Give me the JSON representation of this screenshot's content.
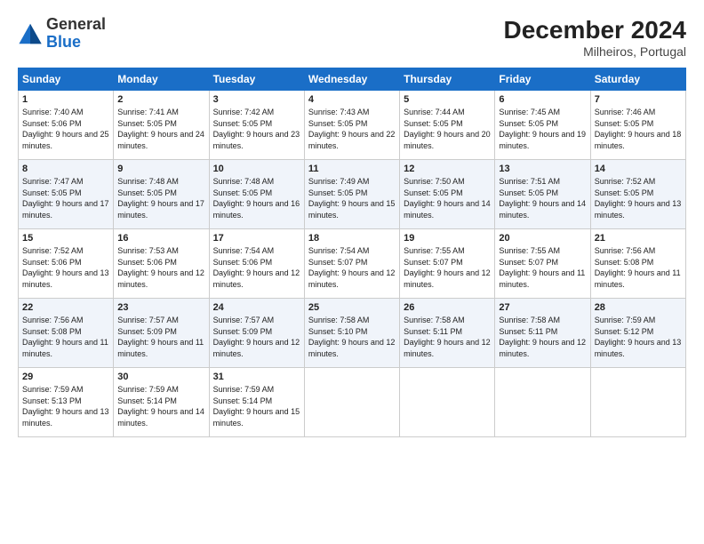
{
  "logo": {
    "general": "General",
    "blue": "Blue"
  },
  "title": "December 2024",
  "subtitle": "Milheiros, Portugal",
  "days": [
    "Sunday",
    "Monday",
    "Tuesday",
    "Wednesday",
    "Thursday",
    "Friday",
    "Saturday"
  ],
  "weeks": [
    [
      {
        "day": 1,
        "sunrise": "7:40 AM",
        "sunset": "5:06 PM",
        "daylight": "9 hours and 25 minutes."
      },
      {
        "day": 2,
        "sunrise": "7:41 AM",
        "sunset": "5:05 PM",
        "daylight": "9 hours and 24 minutes."
      },
      {
        "day": 3,
        "sunrise": "7:42 AM",
        "sunset": "5:05 PM",
        "daylight": "9 hours and 23 minutes."
      },
      {
        "day": 4,
        "sunrise": "7:43 AM",
        "sunset": "5:05 PM",
        "daylight": "9 hours and 22 minutes."
      },
      {
        "day": 5,
        "sunrise": "7:44 AM",
        "sunset": "5:05 PM",
        "daylight": "9 hours and 20 minutes."
      },
      {
        "day": 6,
        "sunrise": "7:45 AM",
        "sunset": "5:05 PM",
        "daylight": "9 hours and 19 minutes."
      },
      {
        "day": 7,
        "sunrise": "7:46 AM",
        "sunset": "5:05 PM",
        "daylight": "9 hours and 18 minutes."
      }
    ],
    [
      {
        "day": 8,
        "sunrise": "7:47 AM",
        "sunset": "5:05 PM",
        "daylight": "9 hours and 17 minutes."
      },
      {
        "day": 9,
        "sunrise": "7:48 AM",
        "sunset": "5:05 PM",
        "daylight": "9 hours and 17 minutes."
      },
      {
        "day": 10,
        "sunrise": "7:48 AM",
        "sunset": "5:05 PM",
        "daylight": "9 hours and 16 minutes."
      },
      {
        "day": 11,
        "sunrise": "7:49 AM",
        "sunset": "5:05 PM",
        "daylight": "9 hours and 15 minutes."
      },
      {
        "day": 12,
        "sunrise": "7:50 AM",
        "sunset": "5:05 PM",
        "daylight": "9 hours and 14 minutes."
      },
      {
        "day": 13,
        "sunrise": "7:51 AM",
        "sunset": "5:05 PM",
        "daylight": "9 hours and 14 minutes."
      },
      {
        "day": 14,
        "sunrise": "7:52 AM",
        "sunset": "5:05 PM",
        "daylight": "9 hours and 13 minutes."
      }
    ],
    [
      {
        "day": 15,
        "sunrise": "7:52 AM",
        "sunset": "5:06 PM",
        "daylight": "9 hours and 13 minutes."
      },
      {
        "day": 16,
        "sunrise": "7:53 AM",
        "sunset": "5:06 PM",
        "daylight": "9 hours and 12 minutes."
      },
      {
        "day": 17,
        "sunrise": "7:54 AM",
        "sunset": "5:06 PM",
        "daylight": "9 hours and 12 minutes."
      },
      {
        "day": 18,
        "sunrise": "7:54 AM",
        "sunset": "5:07 PM",
        "daylight": "9 hours and 12 minutes."
      },
      {
        "day": 19,
        "sunrise": "7:55 AM",
        "sunset": "5:07 PM",
        "daylight": "9 hours and 12 minutes."
      },
      {
        "day": 20,
        "sunrise": "7:55 AM",
        "sunset": "5:07 PM",
        "daylight": "9 hours and 11 minutes."
      },
      {
        "day": 21,
        "sunrise": "7:56 AM",
        "sunset": "5:08 PM",
        "daylight": "9 hours and 11 minutes."
      }
    ],
    [
      {
        "day": 22,
        "sunrise": "7:56 AM",
        "sunset": "5:08 PM",
        "daylight": "9 hours and 11 minutes."
      },
      {
        "day": 23,
        "sunrise": "7:57 AM",
        "sunset": "5:09 PM",
        "daylight": "9 hours and 11 minutes."
      },
      {
        "day": 24,
        "sunrise": "7:57 AM",
        "sunset": "5:09 PM",
        "daylight": "9 hours and 12 minutes."
      },
      {
        "day": 25,
        "sunrise": "7:58 AM",
        "sunset": "5:10 PM",
        "daylight": "9 hours and 12 minutes."
      },
      {
        "day": 26,
        "sunrise": "7:58 AM",
        "sunset": "5:11 PM",
        "daylight": "9 hours and 12 minutes."
      },
      {
        "day": 27,
        "sunrise": "7:58 AM",
        "sunset": "5:11 PM",
        "daylight": "9 hours and 12 minutes."
      },
      {
        "day": 28,
        "sunrise": "7:59 AM",
        "sunset": "5:12 PM",
        "daylight": "9 hours and 13 minutes."
      }
    ],
    [
      {
        "day": 29,
        "sunrise": "7:59 AM",
        "sunset": "5:13 PM",
        "daylight": "9 hours and 13 minutes."
      },
      {
        "day": 30,
        "sunrise": "7:59 AM",
        "sunset": "5:14 PM",
        "daylight": "9 hours and 14 minutes."
      },
      {
        "day": 31,
        "sunrise": "7:59 AM",
        "sunset": "5:14 PM",
        "daylight": "9 hours and 15 minutes."
      },
      null,
      null,
      null,
      null
    ]
  ]
}
